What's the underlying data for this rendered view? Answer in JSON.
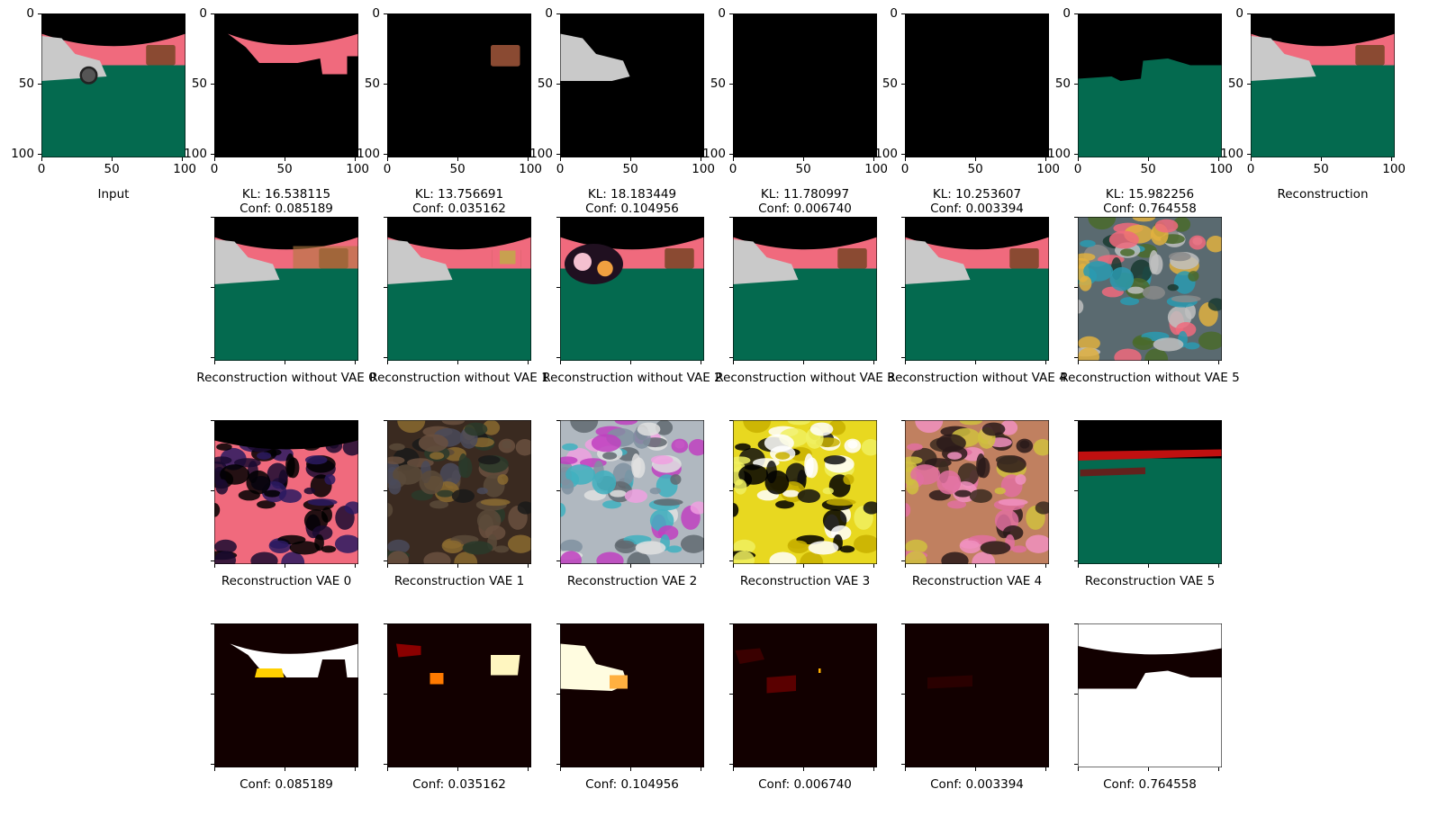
{
  "colors": {
    "black": "#000000",
    "sky": "#f06a7d",
    "ground": "#046a4f",
    "box": "#8a4a32",
    "car": "#c9c9c9"
  },
  "ticks": {
    "x": [
      "0",
      "50",
      "100"
    ],
    "y": [
      "0",
      "50",
      "100"
    ]
  },
  "row1": {
    "titles": [
      "Input",
      "",
      "",
      "",
      "",
      "",
      "",
      "Reconstruction"
    ],
    "kl": [
      "",
      "KL: 16.538115",
      "KL: 13.756691",
      "KL: 18.183449",
      "KL: 11.780997",
      "KL: 10.253607",
      "KL: 15.982256",
      ""
    ],
    "conf": [
      "",
      "Conf: 0.085189",
      "Conf: 0.035162",
      "Conf: 0.104956",
      "Conf: 0.006740",
      "Conf: 0.003394",
      "Conf: 0.764558",
      ""
    ]
  },
  "row2": {
    "titles": [
      "Reconstruction without VAE 0",
      "Reconstruction without VAE 1",
      "Reconstruction without VAE 2",
      "Reconstruction without VAE 3",
      "Reconstruction without VAE 4",
      "Reconstruction without VAE 5"
    ]
  },
  "row3": {
    "titles": [
      "Reconstruction VAE 0",
      "Reconstruction VAE 1",
      "Reconstruction VAE 2",
      "Reconstruction VAE 3",
      "Reconstruction VAE 4",
      "Reconstruction VAE 5"
    ]
  },
  "row4": {
    "titles": [
      "Conf: 0.085189",
      "Conf: 0.035162",
      "Conf: 0.104956",
      "Conf: 0.006740",
      "Conf: 0.003394",
      "Conf: 0.764558"
    ]
  }
}
